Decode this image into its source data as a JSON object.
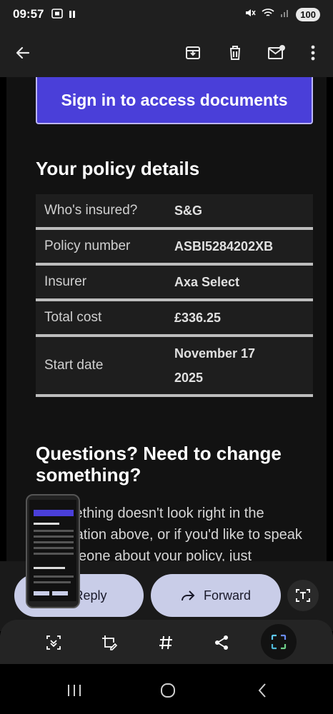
{
  "status": {
    "time": "09:57",
    "battery": "100"
  },
  "email": {
    "signin_button": "Sign in to access documents",
    "policy_heading": "Your policy details",
    "policy_rows": [
      {
        "label": "Who's insured?",
        "value": "S&G"
      },
      {
        "label": "Policy number",
        "value": "ASBI5284202XB"
      },
      {
        "label": "Insurer",
        "value": "Axa Select"
      },
      {
        "label": "Total cost",
        "value": "£336.25"
      },
      {
        "label": "Start date",
        "value": "November 17 2025"
      }
    ],
    "questions_heading": "Questions? Need to change something?",
    "questions_body": "If something doesn't look right in the information above, or if you'd like to speak to someone about your policy, just"
  },
  "actions": {
    "reply": "Reply",
    "forward": "Forward"
  }
}
